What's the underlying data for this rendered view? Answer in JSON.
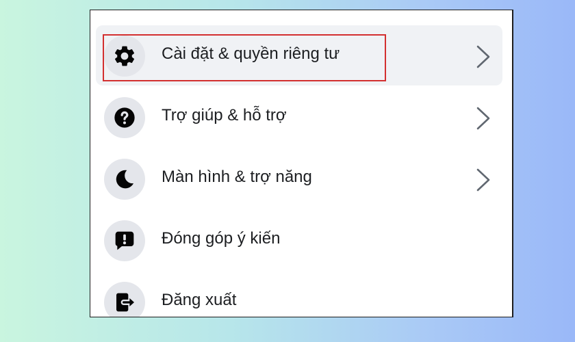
{
  "menu": {
    "items": [
      {
        "label": "Cài đặt & quyền riêng tư",
        "icon": "gear-icon",
        "has_chevron": true,
        "hovered": true,
        "highlighted": true
      },
      {
        "label": "Trợ giúp & hỗ trợ",
        "icon": "question-icon",
        "has_chevron": true
      },
      {
        "label": "Màn hình & trợ năng",
        "icon": "moon-icon",
        "has_chevron": true
      },
      {
        "label": "Đóng góp ý kiến",
        "icon": "feedback-icon",
        "has_chevron": false
      },
      {
        "label": "Đăng xuất",
        "icon": "logout-icon",
        "has_chevron": false
      }
    ]
  },
  "colors": {
    "highlight_border": "#d32f2f",
    "hover_background": "#f0f2f5",
    "icon_background": "#e4e6eb",
    "icon_color": "#050505"
  }
}
